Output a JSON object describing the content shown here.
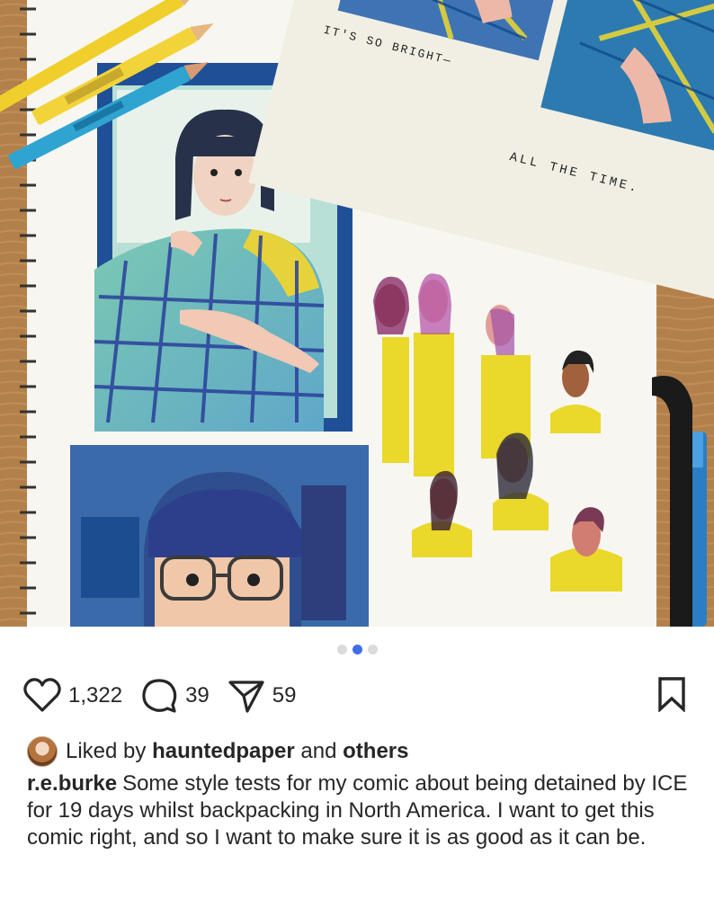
{
  "image": {
    "description_icons": [
      "sketchbook-page",
      "comic-panel-bed",
      "comic-panel-glasses",
      "character-studies",
      "loose-page",
      "pencils"
    ],
    "panel_text_1": "IT'S SO BRIGHT—",
    "panel_text_2": "ALL THE TIME."
  },
  "carousel": {
    "total": 3,
    "active_index": 1
  },
  "actions": {
    "like_count": "1,322",
    "comment_count": "39",
    "share_count": "59",
    "like_icon": "heart-icon",
    "comment_icon": "comment-icon",
    "share_icon": "send-icon",
    "bookmark_icon": "bookmark-icon"
  },
  "likes": {
    "prefix": "Liked by",
    "user": "hauntedpaper",
    "joiner": "and",
    "others": "others"
  },
  "caption": {
    "username": "r.e.burke",
    "text": "Some style tests for my comic about being detained by ICE for 19 days whilst backpacking in North America. I want to get this comic right, and so I want to make sure it is as good as it can be."
  },
  "colors": {
    "accent_blue": "#3f6fe8",
    "text": "#262626",
    "dot_inactive": "#dbdbdb"
  }
}
